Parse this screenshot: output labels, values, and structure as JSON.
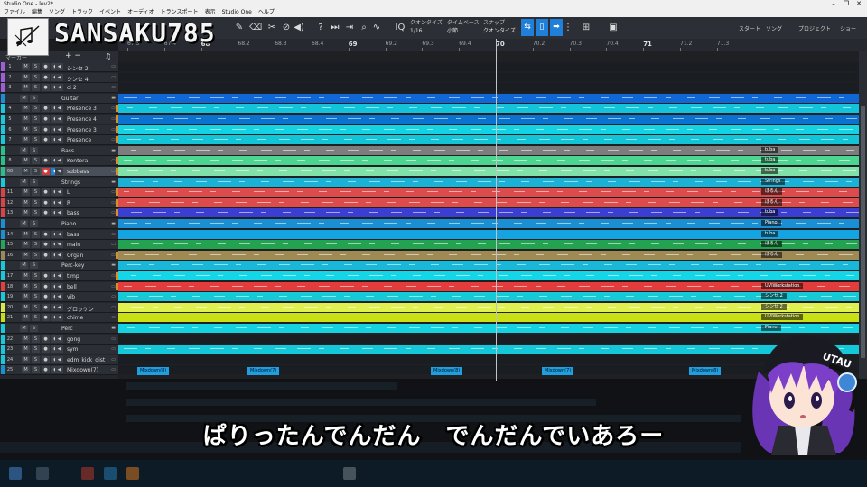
{
  "window": {
    "title": "Studio One - lev2*",
    "controls": [
      "–",
      "❐",
      "✕"
    ]
  },
  "menu": [
    "ファイル",
    "編集",
    "ソング",
    "トラック",
    "イベント",
    "オーディオ",
    "トランスポート",
    "表示",
    "Studio One",
    "ヘルプ"
  ],
  "overlay": {
    "channel_name": "SANSAKU785"
  },
  "toolbar": {
    "quantize_label": "クオンタイズ",
    "quantize_value": "1/16",
    "timebase_label": "タイムベース",
    "timebase_value": "小節",
    "snap_label": "スナップ",
    "snap_value": "クオンタイズ",
    "right_tabs": [
      "スタート",
      "ソング",
      "プロジェクト",
      "ショー"
    ]
  },
  "ruler": {
    "ticks": [
      "67.3",
      "67.4",
      "68",
      "68.2",
      "68.3",
      "68.4",
      "69",
      "69.2",
      "69.3",
      "69.4",
      "70",
      "70.2",
      "70.3",
      "70.4",
      "71",
      "71.2",
      "71.3"
    ]
  },
  "tracklist": {
    "header_label": "マーカー"
  },
  "tracks": [
    {
      "num": "1",
      "name": "シンセ 2",
      "color": "#9c5fd6",
      "folder": false
    },
    {
      "num": "2",
      "name": "シンセ 4",
      "color": "#9c5fd6",
      "folder": false
    },
    {
      "num": "3",
      "name": "ci 2",
      "color": "#9c5fd6",
      "folder": false
    },
    {
      "num": "",
      "name": "Guitar",
      "color": "#1b8fd4",
      "folder": true
    },
    {
      "num": "4",
      "name": "Presence 3",
      "color": "#17c9d9",
      "folder": false
    },
    {
      "num": "5",
      "name": "Presence 4",
      "color": "#17c9d9",
      "folder": false
    },
    {
      "num": "6",
      "name": "Presence 3",
      "color": "#17c9d9",
      "folder": false
    },
    {
      "num": "7",
      "name": "Presence",
      "color": "#17c9d9",
      "folder": false
    },
    {
      "num": "",
      "name": "Bass",
      "color": "#2bbf8a",
      "folder": true
    },
    {
      "num": "8",
      "name": "Kontora",
      "color": "#2bbf8a",
      "folder": false
    },
    {
      "num": "68",
      "name": "subbass",
      "color": "#2bbf8a",
      "folder": false,
      "selected": true
    },
    {
      "num": "",
      "name": "Strings",
      "color": "#17c9d9",
      "folder": true
    },
    {
      "num": "11",
      "name": "L",
      "color": "#d64545",
      "folder": false
    },
    {
      "num": "12",
      "name": "R",
      "color": "#d64545",
      "folder": false
    },
    {
      "num": "13",
      "name": "bass",
      "color": "#d64545",
      "folder": false
    },
    {
      "num": "",
      "name": "Piano",
      "color": "#1b8fd4",
      "folder": true
    },
    {
      "num": "14",
      "name": "bass",
      "color": "#1b8fd4",
      "folder": false
    },
    {
      "num": "15",
      "name": "main",
      "color": "#27a35a",
      "folder": false
    },
    {
      "num": "16",
      "name": "Organ",
      "color": "#9a8a5a",
      "folder": false
    },
    {
      "num": "",
      "name": "Perc-key",
      "color": "#17c9d9",
      "folder": true
    },
    {
      "num": "17",
      "name": "timp",
      "color": "#17c9d9",
      "folder": false
    },
    {
      "num": "18",
      "name": "bell",
      "color": "#e04040",
      "folder": false
    },
    {
      "num": "19",
      "name": "vib",
      "color": "#17c9d9",
      "folder": false
    },
    {
      "num": "20",
      "name": "グロッケン",
      "color": "#d6e84a",
      "folder": false
    },
    {
      "num": "21",
      "name": "chime",
      "color": "#c9e010",
      "folder": false
    },
    {
      "num": "",
      "name": "Perc",
      "color": "#17c9d9",
      "folder": true
    },
    {
      "num": "22",
      "name": "gong",
      "color": "#17c9d9",
      "folder": false
    },
    {
      "num": "23",
      "name": "sym",
      "color": "#17c9d9",
      "folder": false
    },
    {
      "num": "24",
      "name": "edm_kick_dist",
      "color": "#17c9d9",
      "folder": false
    },
    {
      "num": "25",
      "name": "Mixdown(7)",
      "color": "#1b8fd4",
      "folder": false
    }
  ],
  "lanes": [
    {
      "color": "#1a1d22",
      "tag": ""
    },
    {
      "color": "#1a1d22",
      "tag": ""
    },
    {
      "color": "#1a1d22",
      "tag": ""
    },
    {
      "color": "#0f68d6",
      "tag": ""
    },
    {
      "color": "#12c3da",
      "tag": ""
    },
    {
      "color": "#0b73cf",
      "tag": ""
    },
    {
      "color": "#14d2e2",
      "tag": ""
    },
    {
      "color": "#13c4d6",
      "tag": ""
    },
    {
      "color": "#7d7d7d",
      "tag": "tuba"
    },
    {
      "color": "#4cd590",
      "tag": "tuba"
    },
    {
      "color": "#80e2a8",
      "tag": "tuba"
    },
    {
      "color": "#1bb2d6",
      "tag": "Strings"
    },
    {
      "color": "#dc4c4c",
      "tag": "ほるん"
    },
    {
      "color": "#dc4c4c",
      "tag": "ほるん"
    },
    {
      "color": "#3a3fd2",
      "tag": "tuba"
    },
    {
      "color": "#1b8fd4",
      "tag": "Piano"
    },
    {
      "color": "#14a4e2",
      "tag": "tuba"
    },
    {
      "color": "#23a24f",
      "tag": "ほるん"
    },
    {
      "color": "#a08a54",
      "tag": "ほるん"
    },
    {
      "color": "#1ab8d8",
      "tag": ""
    },
    {
      "color": "#14d6e6",
      "tag": ""
    },
    {
      "color": "#e23c3c",
      "tag": "UVIWorkstation"
    },
    {
      "color": "#15c9d6",
      "tag": "シンセ 2"
    },
    {
      "color": "#e0f050",
      "tag": "シンセ 2"
    },
    {
      "color": "#c8e014",
      "tag": "UVIWorkstation"
    },
    {
      "color": "#14d2e0",
      "tag": "Piano"
    },
    {
      "color": "#1a1d22",
      "tag": ""
    },
    {
      "color": "#14c8da",
      "tag": ""
    },
    {
      "color": "#1a1d22",
      "tag": ""
    },
    {
      "color": "#1a1d22",
      "tag": ""
    }
  ],
  "mixdown_label": "Mixdown(8)",
  "mixdown_labels": [
    "Mixdown(8)",
    "Mixdown(7)",
    "Mixdown(8)",
    "Mixdown(7)",
    "Mixdown(8)"
  ],
  "subtitle": "ぱりったんでんだん　でんだんでいあろー"
}
